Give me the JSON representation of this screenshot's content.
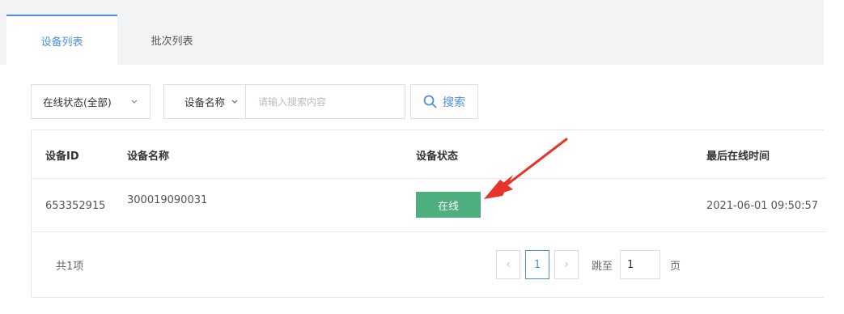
{
  "tabs": [
    {
      "label": "设备列表",
      "active": true
    },
    {
      "label": "批次列表",
      "active": false
    }
  ],
  "filters": {
    "status_select": "在线状态(全部)",
    "field_select": "设备名称",
    "search_placeholder": "请输入搜索内容",
    "search_value": "",
    "search_button": "搜索"
  },
  "table": {
    "headers": [
      "设备ID",
      "设备名称",
      "设备状态",
      "最后在线时间"
    ],
    "rows": [
      {
        "id": "653352915",
        "name": "300019090031",
        "status": "在线",
        "last_online": "2021-06-01 09:50:57"
      }
    ]
  },
  "pagination": {
    "total": "共1项",
    "prev": "‹",
    "current_page": "1",
    "next": "›",
    "jump_label": "跳至",
    "jump_value": "1",
    "page_suffix": "页"
  },
  "colors": {
    "accent": "#4a90e2",
    "status_online": "#4caf7d",
    "annotation_arrow": "#e8332a"
  },
  "icons": [
    "chevron-down-icon",
    "search-icon",
    "chevron-left-icon",
    "chevron-right-icon",
    "annotation-arrow"
  ]
}
